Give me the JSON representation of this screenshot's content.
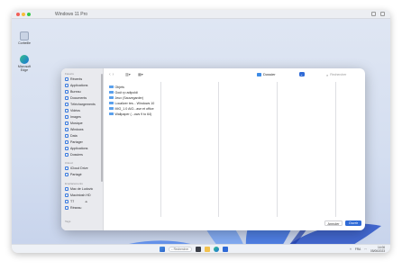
{
  "window": {
    "title": "Windows 11 Pro"
  },
  "desktop": {
    "icons": [
      {
        "label": "Corbeille",
        "icon": "recycle-bin-icon"
      },
      {
        "label": "Microsoft Edge",
        "icon": "edge-icon"
      }
    ]
  },
  "dialog": {
    "sidebar": {
      "sections": [
        {
          "heading": "Favoris",
          "items": [
            {
              "label": "Récents",
              "icon": "clock-icon"
            },
            {
              "label": "Applications",
              "icon": "apps-icon"
            },
            {
              "label": "Bureau",
              "icon": "desktop-icon"
            },
            {
              "label": "Documents",
              "icon": "document-icon"
            },
            {
              "label": "Téléchargements",
              "icon": "download-icon"
            },
            {
              "label": "Vidéos",
              "icon": "video-icon"
            },
            {
              "label": "Images",
              "icon": "image-icon"
            },
            {
              "label": "Musique",
              "icon": "music-icon"
            },
            {
              "label": "Windows",
              "icon": "folder-icon"
            },
            {
              "label": "Data",
              "icon": "folder-icon"
            },
            {
              "label": "Partager",
              "icon": "folder-icon"
            },
            {
              "label": "Applications",
              "icon": "folder-icon"
            },
            {
              "label": "Dossiers",
              "icon": "folder-icon"
            }
          ]
        },
        {
          "heading": "iCloud",
          "items": [
            {
              "label": "iCloud Drive",
              "icon": "cloud-icon"
            },
            {
              "label": "Partagé",
              "icon": "shared-icon"
            }
          ]
        },
        {
          "heading": "Emplacements",
          "items": [
            {
              "label": "Mac de Ludovic",
              "icon": "laptop-icon"
            },
            {
              "label": "Macintosh HD",
              "icon": "disk-icon"
            },
            {
              "label": "T7",
              "icon": "disk-icon"
            },
            {
              "label": "Réseau",
              "icon": "network-icon"
            }
          ]
        },
        {
          "heading": "Tags",
          "items": []
        }
      ]
    },
    "toolbar": {
      "back": "‹",
      "forward": "›",
      "location": "Dossier",
      "search_placeholder": "Rechercher"
    },
    "files": [
      {
        "name": "Objets"
      },
      {
        "name": "Goùt rp adipoldi"
      },
      {
        "name": "Jeux (Sauvegarder)"
      },
      {
        "name": "Localizer tes... Windows 10"
      },
      {
        "name": "MIG_1.0 AIO...ase et office"
      },
      {
        "name": "Wallpaper (...ows 9 to 64)"
      }
    ],
    "buttons": {
      "cancel": "Annuler",
      "open": "Ouvrir"
    }
  },
  "taskbar": {
    "search_label": "Rechercher",
    "time": "14:06",
    "date": "05/06/2023",
    "lang": "FRA"
  },
  "colors": {
    "accent": "#2f6ad6",
    "folder": "#5aa0ec"
  }
}
